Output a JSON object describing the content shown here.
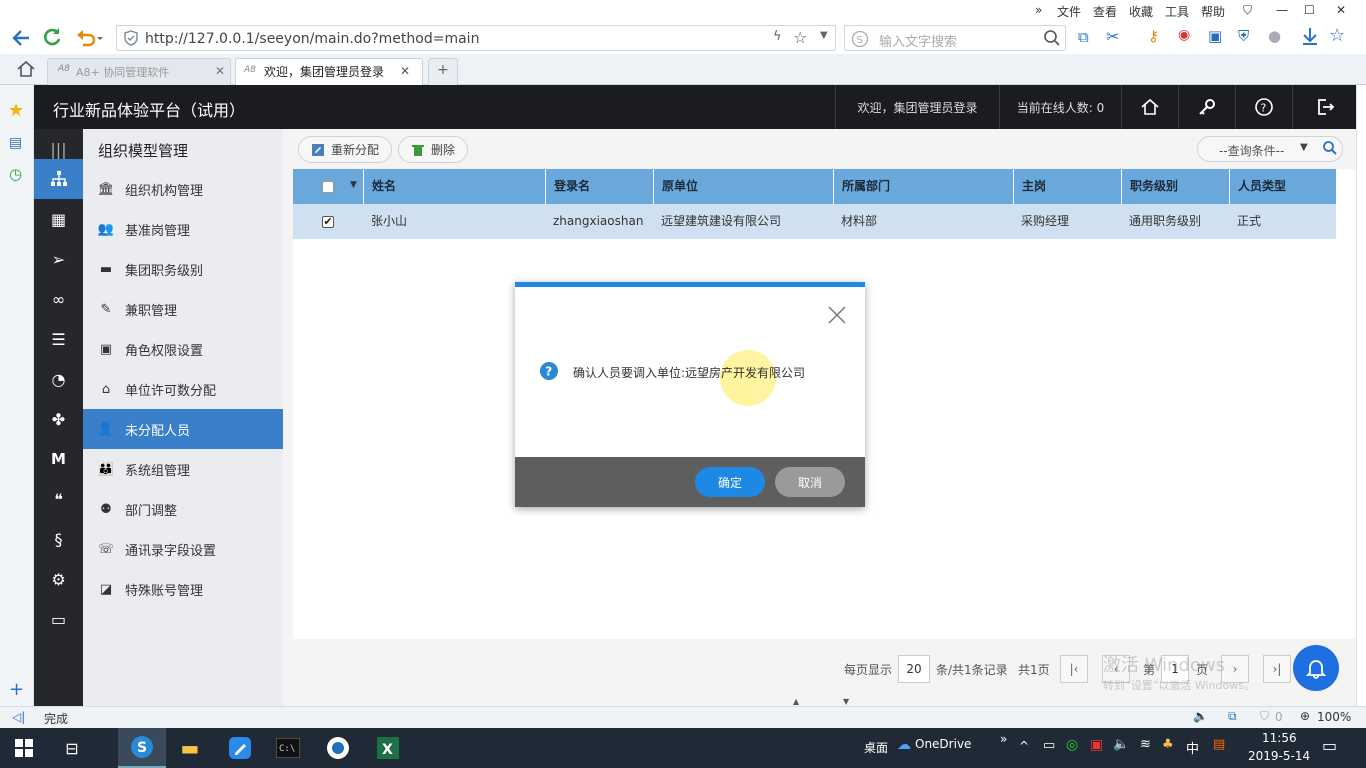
{
  "browser": {
    "menu": [
      "文件",
      "查看",
      "收藏",
      "工具",
      "帮助"
    ],
    "url": "http://127.0.0.1/seeyon/main.do?method=main",
    "search_placeholder": "输入文字搜索",
    "tabs": [
      {
        "label": "A8+ 协同管理软件"
      },
      {
        "label": "欢迎，集团管理员登录"
      }
    ],
    "new_tab": "+"
  },
  "app": {
    "title": "行业新品体验平台（试用）",
    "welcome": "欢迎，集团管理员登录",
    "online": "当前在线人数: 0"
  },
  "sidebar": {
    "title": "组织模型管理",
    "items": [
      {
        "label": "组织机构管理"
      },
      {
        "label": "基准岗管理"
      },
      {
        "label": "集团职务级别"
      },
      {
        "label": "兼职管理"
      },
      {
        "label": "角色权限设置"
      },
      {
        "label": "单位许可数分配"
      },
      {
        "label": "未分配人员"
      },
      {
        "label": "系统组管理"
      },
      {
        "label": "部门调整"
      },
      {
        "label": "通讯录字段设置"
      },
      {
        "label": "特殊账号管理"
      }
    ],
    "active_index": 6
  },
  "toolbar": {
    "reassign": "重新分配",
    "delete": "删除",
    "query": "--查询条件--"
  },
  "table": {
    "columns": [
      "姓名",
      "登录名",
      "原单位",
      "所属部门",
      "主岗",
      "职务级别",
      "人员类型"
    ],
    "rows": [
      [
        "张小山",
        "zhangxiaoshan",
        "远望建筑建设有限公司",
        "材料部",
        "采购经理",
        "通用职务级别",
        "正式"
      ]
    ]
  },
  "pager": {
    "per_page_label": "每页显示",
    "per_page": "20",
    "records": "条/共1条记录",
    "pages": "共1页",
    "page_prefix": "第",
    "page": "1",
    "page_suffix": "页"
  },
  "dialog": {
    "message": "确认人员要调入单位:远望房产开发有限公司",
    "ok": "确定",
    "cancel": "取消"
  },
  "status": {
    "text": "完成",
    "blocked": "0",
    "zoom": "100%"
  },
  "taskbar": {
    "desktop": "桌面",
    "onedrive": "OneDrive",
    "ime": "中",
    "time": "11:56",
    "date": "2019-5-14"
  },
  "watermark": {
    "line1": "激活 Windows",
    "line2": "转到“设置”以激活 Windows。"
  },
  "colors": {
    "accent": "#1e88e5",
    "active_menu": "#3a7fc9",
    "header": "#1b1c20",
    "table_header": "#6aa8dc",
    "selected_row": "#cfe0f0"
  }
}
